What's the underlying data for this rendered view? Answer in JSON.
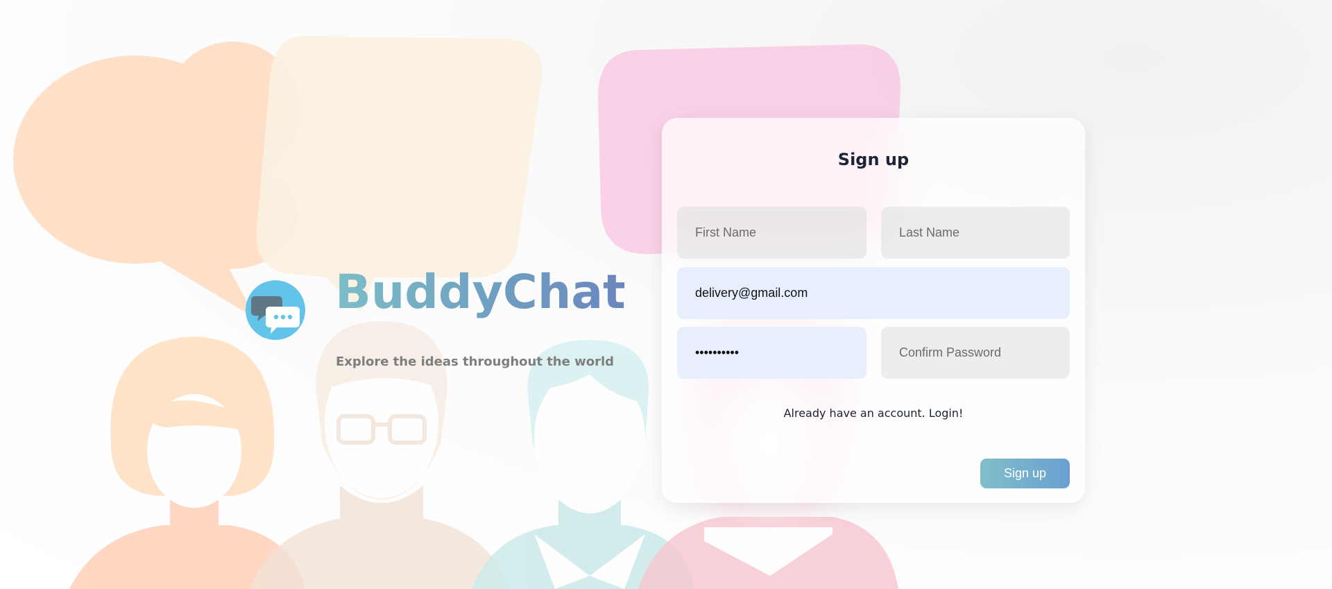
{
  "brand": {
    "name": "BuddyChat",
    "tagline": "Explore the ideas throughout the world",
    "logo_icon": "chat-bubbles-icon"
  },
  "signup": {
    "title": "Sign up",
    "first_name": {
      "value": "",
      "placeholder": "First Name"
    },
    "last_name": {
      "value": "",
      "placeholder": "Last Name"
    },
    "email": {
      "value": "delivery@gmail.com",
      "placeholder": ""
    },
    "password": {
      "value": "••••••••••",
      "placeholder": ""
    },
    "confirm_password": {
      "value": "",
      "placeholder": "Confirm Password"
    },
    "login_link": "Already have an account. Login!",
    "submit_label": "Sign up"
  },
  "colors": {
    "brand_gradient_start": "#7cbec8",
    "brand_gradient_end": "#6a86bd",
    "logo_background": "#63c3e8",
    "button_gradient_start": "#80bfc8",
    "button_gradient_end": "#6a9fd1",
    "filled_input": "#e8effc"
  }
}
